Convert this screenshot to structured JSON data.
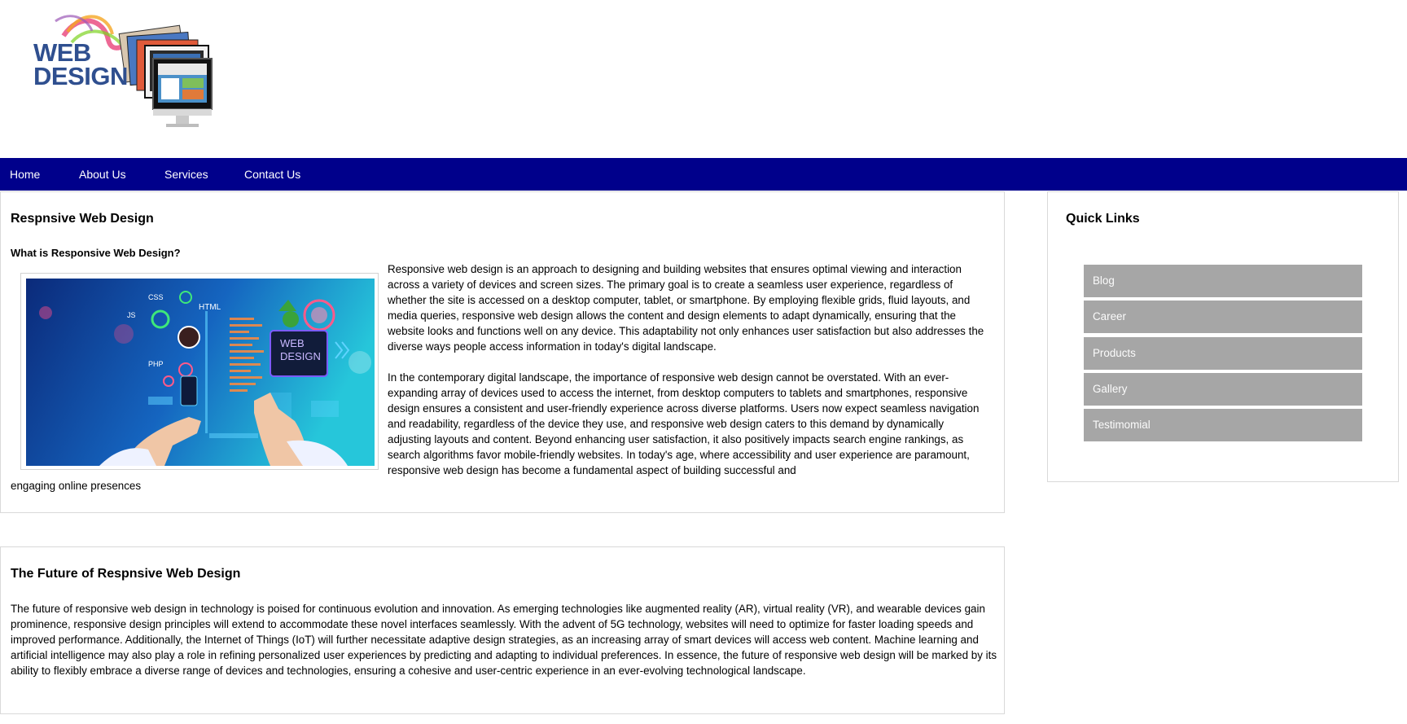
{
  "logo": {
    "line1": "WEB",
    "line2": "DESIGN"
  },
  "nav": {
    "items": [
      {
        "label": "Home"
      },
      {
        "label": "About Us"
      },
      {
        "label": "Services"
      },
      {
        "label": "Contact Us"
      }
    ],
    "background": "#00008b"
  },
  "article": {
    "title": "Respnsive Web Design",
    "subtitle": "What is Responsive Web Design?",
    "image_text": {
      "css": "CSS",
      "js": "JS",
      "html": "HTML",
      "php": "PHP",
      "badge_line1": "WEB",
      "badge_line2": "DESIGN"
    },
    "para1": "Responsive web design is an approach to designing and building websites that ensures optimal viewing and interaction across a variety of devices and screen sizes. The primary goal is to create a seamless user experience, regardless of whether the site is accessed on a desktop computer, tablet, or smartphone. By employing flexible grids, fluid layouts, and media queries, responsive web design allows the content and design elements to adapt dynamically, ensuring that the website looks and functions well on any device. This adaptability not only enhances user satisfaction but also addresses the diverse ways people access information in today's digital landscape.",
    "para2": "In the contemporary digital landscape, the importance of responsive web design cannot be overstated. With an ever-expanding array of devices used to access the internet, from desktop computers to tablets and smartphones, responsive design ensures a consistent and user-friendly experience across diverse platforms. Users now expect seamless navigation and readability, regardless of the device they use, and responsive web design caters to this demand by dynamically adjusting layouts and content. Beyond enhancing user satisfaction, it also positively impacts search engine rankings, as search algorithms favor mobile-friendly websites. In today's age, where accessibility and user experience are paramount, responsive web design has become a fundamental aspect of building successful and engaging online presences"
  },
  "future": {
    "title": "The Future of Respnsive Web Design",
    "para": "The future of responsive web design in technology is poised for continuous evolution and innovation. As emerging technologies like augmented reality (AR), virtual reality (VR), and wearable devices gain prominence, responsive design principles will extend to accommodate these novel interfaces seamlessly. With the advent of 5G technology, websites will need to optimize for faster loading speeds and improved performance. Additionally, the Internet of Things (IoT) will further necessitate adaptive design strategies, as an increasing array of smart devices will access web content. Machine learning and artificial intelligence may also play a role in refining personalized user experiences by predicting and adapting to individual preferences. In essence, the future of responsive web design will be marked by its ability to flexibly embrace a diverse range of devices and technologies, ensuring a cohesive and user-centric experience in an ever-evolving technological landscape."
  },
  "quick_links": {
    "title": "Quick Links",
    "items": [
      {
        "label": "Blog"
      },
      {
        "label": "Career"
      },
      {
        "label": "Products"
      },
      {
        "label": "Gallery"
      },
      {
        "label": "Testimomial"
      }
    ],
    "item_background": "#a6a6a6"
  }
}
